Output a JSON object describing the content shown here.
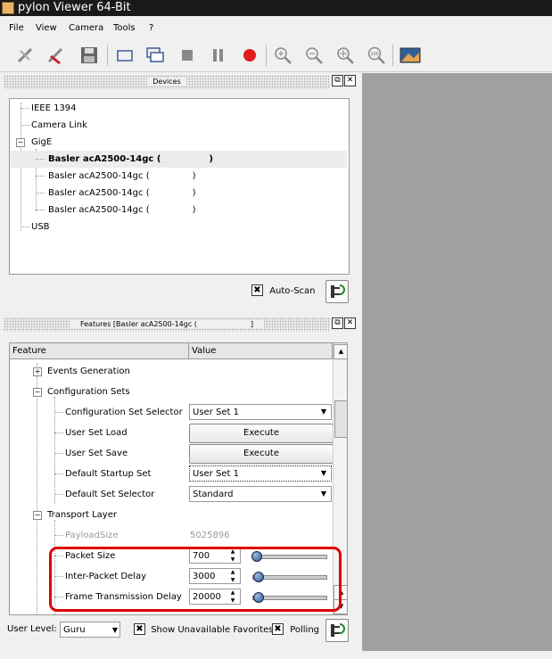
{
  "window": {
    "title": "pylon Viewer 64-Bit"
  },
  "menu": {
    "items": [
      "File",
      "View",
      "Camera",
      "Tools",
      "?"
    ]
  },
  "toolbar": {
    "icons": [
      "connect-icon",
      "disconnect-icon",
      "save-icon",
      "single-shot-icon",
      "continuous-shot-icon",
      "stop-icon",
      "pause-icon",
      "record-icon",
      "zoom-in-icon",
      "zoom-out-icon",
      "zoom-fit-icon",
      "zoom-100-icon",
      "image-window-icon"
    ],
    "zoom_100_label": "100",
    "record_color": "#e11b1b"
  },
  "devices": {
    "title": "Devices",
    "tree": [
      {
        "label": "IEEE 1394",
        "level": 0
      },
      {
        "label": "Camera Link",
        "level": 0
      },
      {
        "label": "GigE",
        "level": 0,
        "expanded": true
      },
      {
        "label": "Basler acA2500-14gc (",
        "suffix": ")",
        "level": 1,
        "selected": true
      },
      {
        "label": "Basler acA2500-14gc (",
        "suffix": ")",
        "level": 1
      },
      {
        "label": "Basler acA2500-14gc (",
        "suffix": ")",
        "level": 1
      },
      {
        "label": "Basler acA2500-14gc (",
        "suffix": ")",
        "level": 1
      },
      {
        "label": "USB",
        "level": 0
      }
    ],
    "auto_scan_label": "Auto-Scan",
    "auto_scan_checked": true
  },
  "features": {
    "title": "Features [Basler acA2500-14gc (",
    "title_suffix": "]",
    "col_feature": "Feature",
    "col_value": "Value",
    "rows": [
      {
        "kind": "group",
        "label": "Events Generation",
        "expanded": false
      },
      {
        "kind": "group",
        "label": "Configuration Sets",
        "expanded": true
      },
      {
        "kind": "combo",
        "label": "Configuration Set Selector",
        "value": "User Set 1"
      },
      {
        "kind": "button",
        "label": "User Set Load",
        "value": "Execute"
      },
      {
        "kind": "button",
        "label": "User Set Save",
        "value": "Execute"
      },
      {
        "kind": "combo",
        "label": "Default Startup Set",
        "value": "User Set 1"
      },
      {
        "kind": "combo",
        "label": "Default Set Selector",
        "value": "Standard"
      },
      {
        "kind": "group",
        "label": "Transport Layer",
        "expanded": true
      },
      {
        "kind": "readonly",
        "label": "PayloadSize",
        "value": "5025896"
      },
      {
        "kind": "slider",
        "label": "Packet Size",
        "value": "700",
        "level": 0.0
      },
      {
        "kind": "slider",
        "label": "Inter-Packet Delay",
        "value": "3000",
        "level": 0.02
      },
      {
        "kind": "slider",
        "label": "Frame Transmission Delay",
        "value": "20000",
        "level": 0.02
      }
    ]
  },
  "bottom": {
    "user_level_label": "User Level:",
    "user_level_value": "Guru",
    "show_unavailable_label": "Show Unavailable Favorites",
    "show_unavailable_checked": true,
    "polling_label": "Polling",
    "polling_checked": true
  },
  "colors": {
    "highlight": "#d00000",
    "viewer_bg": "#a0a0a0"
  }
}
